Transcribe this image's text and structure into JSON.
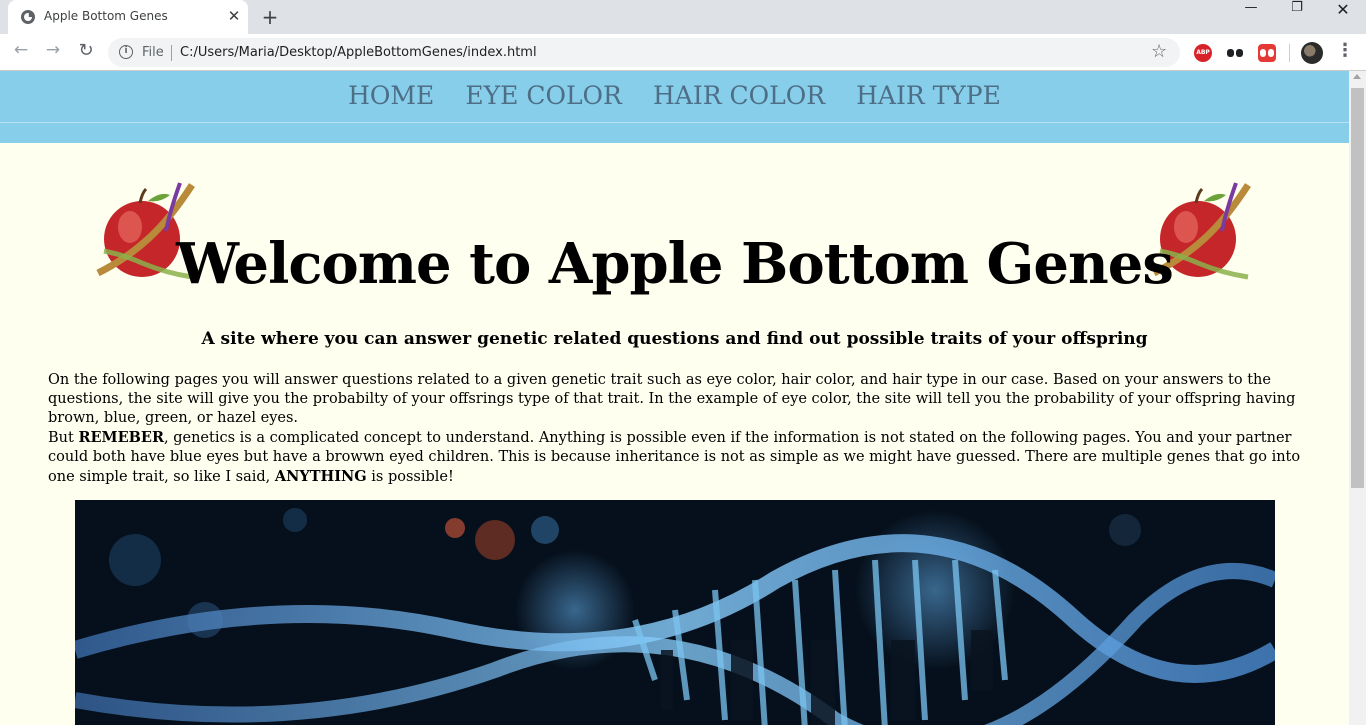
{
  "browser": {
    "tab_title": "Apple Bottom Genes",
    "tab_close_icon": "close-icon",
    "new_tab_symbol": "+",
    "file_label": "File",
    "url": "C:/Users/Maria/Desktop/AppleBottomGenes/index.html",
    "extensions": [
      "adblock-plus-icon",
      "extension-icon",
      "extension-icon-red"
    ],
    "abp_text": "ABP"
  },
  "nav": {
    "items": [
      "HOME",
      "EYE COLOR",
      "HAIR COLOR",
      "HAIR TYPE"
    ]
  },
  "page": {
    "title": "Welcome to Apple Bottom Genes",
    "subtitle": "A site where you can answer genetic related questions and find out possible traits of your offspring",
    "paragraph1": "On the following pages you will answer questions related to a given genetic trait such as eye color, hair color, and hair type in our case. Based on your answers to the questions, the site will give you the probabilty of your offsrings type of that trait. In the example of eye color, the site will tell you the probability of your offspring having brown, blue, green, or hazel eyes.",
    "paragraph2_before": "But ",
    "paragraph2_bold1": "REMEBER",
    "paragraph2_middle": ", genetics is a complicated concept to understand. Anything is possible even if the information is not stated on the following pages. You and your partner could both have blue eyes but have a browwn eyed children. This is because inheritance is not as simple as we might have guessed. There are multiple genes that go into one simple trait, so like I said, ",
    "paragraph2_bold2": "ANYTHING",
    "paragraph2_after": " is possible!"
  },
  "colors": {
    "navbar": "#87ceeb",
    "page_bg": "#fffff0",
    "nav_text": "#4e6e86"
  }
}
